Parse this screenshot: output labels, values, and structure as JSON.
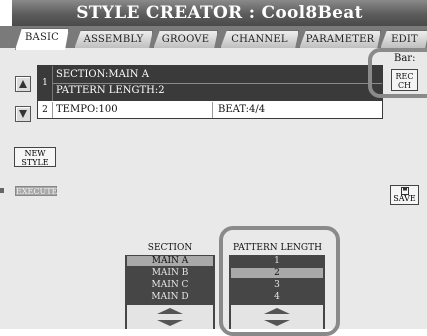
{
  "title": "STYLE CREATOR : Cool8Beat",
  "tabs": [
    {
      "label": "BASIC",
      "active": true
    },
    {
      "label": "ASSEMBLY",
      "active": false
    },
    {
      "label": "GROOVE",
      "active": false
    },
    {
      "label": "CHANNEL",
      "active": false
    },
    {
      "label": "PARAMETER",
      "active": false
    },
    {
      "label": "EDIT",
      "active": false
    }
  ],
  "info_table": {
    "row1": {
      "number": "1",
      "line1": "SECTION:MAIN A",
      "line2": "PATTERN LENGTH:2"
    },
    "row2": {
      "number": "2",
      "tempo": "TEMPO:100",
      "beat": "BEAT:4/4"
    }
  },
  "nav_buttons": {
    "up_icon": "triangle-up-icon",
    "down_icon": "triangle-down-icon"
  },
  "bar": {
    "label": "Bar:",
    "rec_button_line1": "REC",
    "rec_button_line2": "CH"
  },
  "new_style_button": {
    "line1": "NEW",
    "line2": "STYLE"
  },
  "execute_button": "EXECUTE",
  "save_button": {
    "label": "SAVE",
    "icon": "floppy-disk-icon"
  },
  "section_list": {
    "title": "SECTION",
    "items": [
      "MAIN A",
      "MAIN B",
      "MAIN C",
      "MAIN D"
    ],
    "selected_index": 0
  },
  "pattern_length_list": {
    "title": "PATTERN LENGTH",
    "items": [
      "1",
      "2",
      "3",
      "4"
    ],
    "selected_index": 1
  },
  "colors": {
    "title_bar": "#5c5c5c",
    "table_selected_row": "#3a3a3a",
    "list_background": "#464646",
    "list_selected": "#a9a9a9",
    "highlight_outline": "#8a8a8a"
  }
}
